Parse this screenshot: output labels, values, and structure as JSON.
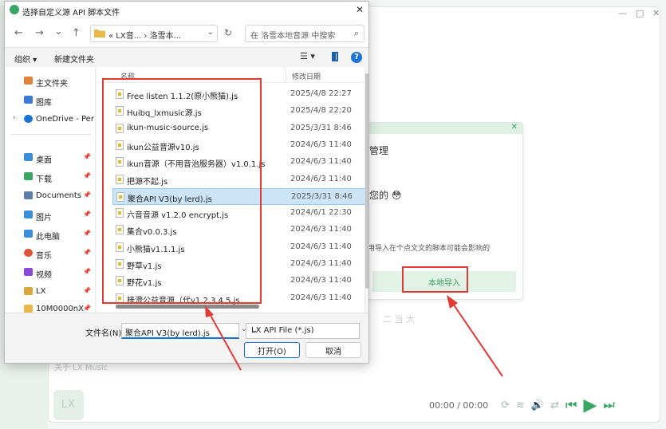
{
  "background_app": {
    "window_controls": [
      "—",
      "□",
      "✕"
    ],
    "logo_text": "LX",
    "time_display": "00:00 / 00:00",
    "footer_text": "关于 LX Music",
    "mid_text": "二 当 大",
    "import_panel": {
      "close_icon": "✕",
      "text1": "管理",
      "text2": "您的 😳",
      "warning": "用导入在个点文文的脚本可能会影响的",
      "local_import_label": "本地导入"
    }
  },
  "dialog": {
    "title": "选择自定义源 API 脚本文件",
    "close_icon": "✕",
    "nav": {
      "back": "←",
      "forward": "→",
      "recent": "⌄",
      "up": "↑",
      "address": "« LX音... › 洛雪本...",
      "refresh": "↻",
      "search_placeholder": "在 洛雪本地音源 中搜索",
      "search_icon": "⌕"
    },
    "toolbar": {
      "organize": "组织 ▾",
      "new_folder": "新建文件夹",
      "view": "☰ ▾",
      "help": "?"
    },
    "navpane": [
      {
        "label": "主文件夹",
        "icon_color": "#e0833a",
        "pin": false,
        "chevron": false
      },
      {
        "label": "图库",
        "icon_color": "#3a7bd5",
        "pin": false,
        "chevron": false
      },
      {
        "label": "OneDrive - Per",
        "icon_color": "#1a73d9",
        "pin": false,
        "chevron": true
      },
      {
        "label": "桌面",
        "icon_color": "#3a8fd9",
        "pin": true,
        "chevron": false
      },
      {
        "label": "下载",
        "icon_color": "#3aa664",
        "pin": true,
        "chevron": false
      },
      {
        "label": "Documents",
        "icon_color": "#5a7fa8",
        "pin": true,
        "chevron": false
      },
      {
        "label": "图片",
        "icon_color": "#3a8fd9",
        "pin": true,
        "chevron": false
      },
      {
        "label": "此电脑",
        "icon_color": "#3a8fd9",
        "pin": true,
        "chevron": false
      },
      {
        "label": "音乐",
        "icon_color": "#e0533a",
        "pin": true,
        "chevron": false
      },
      {
        "label": "视频",
        "icon_color": "#8a4ad9",
        "pin": true,
        "chevron": false
      },
      {
        "label": "LX",
        "icon_color": "#d9a83a",
        "pin": true,
        "chevron": false
      },
      {
        "label": "10M0000nX",
        "icon_color": "#e8b84a",
        "pin": true,
        "chevron": false
      }
    ],
    "columns": {
      "name": "名称",
      "date": "修改日期"
    },
    "files": [
      {
        "name": "Free listen 1.1.2(原小熊猫).js",
        "date": "2025/4/8 22:27",
        "selected": false
      },
      {
        "name": "Huibq_lxmusic源.js",
        "date": "2025/4/8 22:20",
        "selected": false
      },
      {
        "name": "ikun-music-source.js",
        "date": "2025/3/31 8:46",
        "selected": false
      },
      {
        "name": "ikun公益音源v10.js",
        "date": "2024/6/3 11:40",
        "selected": false
      },
      {
        "name": "ikun音源（不用音治服务器）v1.0.1.js",
        "date": "2024/6/3 11:40",
        "selected": false
      },
      {
        "name": "把源不起.js",
        "date": "2024/6/3 11:40",
        "selected": false
      },
      {
        "name": "聚合API V3(by lerd).js",
        "date": "2025/3/31 8:46",
        "selected": true
      },
      {
        "name": "六音音源 v1.2.0 encrypt.js",
        "date": "2024/6/1 22:30",
        "selected": false
      },
      {
        "name": "集合v0.0.3.js",
        "date": "2024/6/3 11:40",
        "selected": false
      },
      {
        "name": "小熊猫v1.1.1.js",
        "date": "2024/6/3 11:40",
        "selected": false
      },
      {
        "name": "野草v1.js",
        "date": "2024/6/3 11:40",
        "selected": false
      },
      {
        "name": "野花v1.js",
        "date": "2024/6/3 11:40",
        "selected": false
      },
      {
        "name": "梓澄公益音源（代v1.2.3.4.5.js",
        "date": "2024/6/3 11:40",
        "selected": false
      }
    ],
    "bottom": {
      "filename_label": "文件名(N):",
      "filename_value": "聚合API V3(by lerd).js",
      "filetype_value": "LX API File (*.js)",
      "open_label": "打开(O)",
      "cancel_label": "取消"
    }
  },
  "player": {
    "icons": [
      "⟳",
      "≋",
      "🔊",
      "⇄",
      "⏮",
      "▶",
      "⏭"
    ]
  }
}
